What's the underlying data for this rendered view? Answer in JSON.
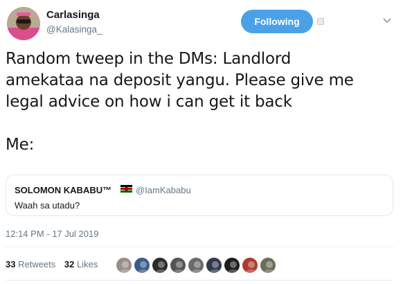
{
  "user": {
    "name": "Carlasinga",
    "handle": "@Kalasinga_"
  },
  "follow_button": {
    "label": "Following",
    "color": "#4aa1e8"
  },
  "tweet": {
    "text": "Random tweep in the DMs: Landlord\namekataa na deposit yangu. Please give me\nlegal advice on how i can get it back\n\nMe:"
  },
  "quote": {
    "name": "SOLOMON KABABU™",
    "handle": "@IamKababu",
    "text": "Waah sa utadu?"
  },
  "timestamp": "12:14 PM - 17 Jul 2019",
  "stats": {
    "retweets_count": "33",
    "retweets_label": "Retweets",
    "likes_count": "32",
    "likes_label": "Likes"
  },
  "likers": [
    {
      "icon": "avatar-1",
      "color": "#9a8f86"
    },
    {
      "icon": "avatar-2",
      "color": "#3b5c88"
    },
    {
      "icon": "avatar-3",
      "color": "#2b2b2b"
    },
    {
      "icon": "avatar-4",
      "color": "#555555"
    },
    {
      "icon": "avatar-5",
      "color": "#6b6b6b"
    },
    {
      "icon": "avatar-6",
      "color": "#303a48"
    },
    {
      "icon": "avatar-7",
      "color": "#1e1e1e"
    },
    {
      "icon": "avatar-8",
      "color": "#b03a2e"
    },
    {
      "icon": "avatar-9",
      "color": "#6d6d5a"
    }
  ]
}
